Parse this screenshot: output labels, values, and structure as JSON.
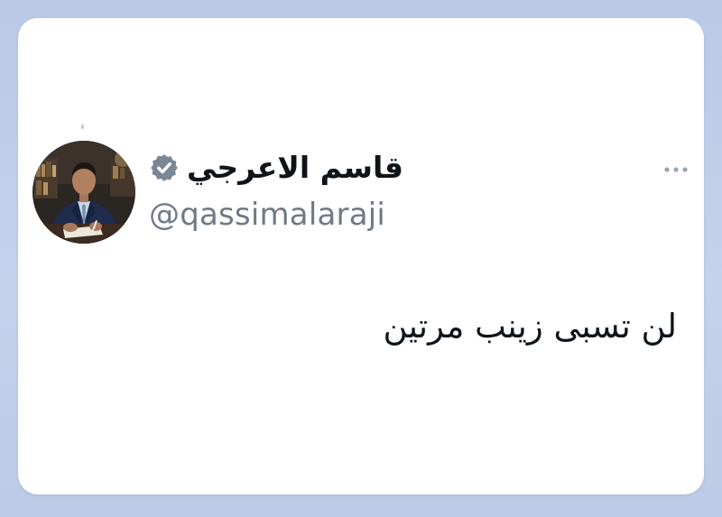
{
  "tweet": {
    "author": {
      "display_name": "قاسم الاعرجي",
      "handle": "@qassimalaraji",
      "verified": true,
      "avatar_icon": "profile-photo"
    },
    "text": "لن تسبى زينب مرتين",
    "more_icon": "more-options-icon"
  },
  "colors": {
    "background": "#c0cfe9",
    "card": "#ffffff",
    "name": "#0f1419",
    "handle": "#6f7a86",
    "verified_badge": "#7b8794",
    "more_icon": "#9aa4b0"
  }
}
